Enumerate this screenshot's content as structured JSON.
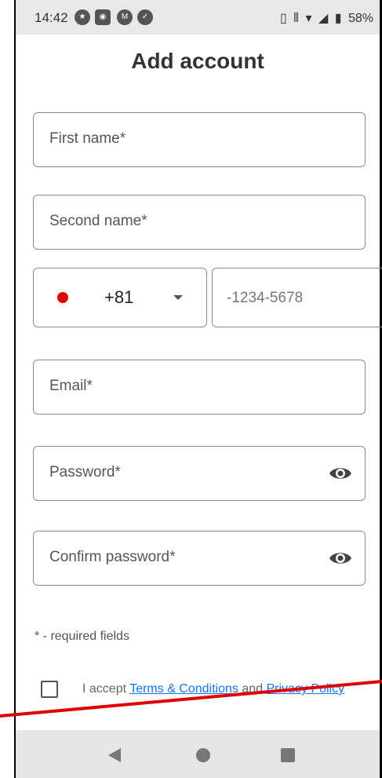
{
  "status_bar": {
    "time": "14:42",
    "battery": "58%"
  },
  "page": {
    "title": "Add account"
  },
  "form": {
    "first_name_placeholder": "First name*",
    "second_name_placeholder": "Second name*",
    "country_code": "+81",
    "phone_placeholder": "-1234-5678",
    "email_placeholder": "Email*",
    "password_placeholder": "Password*",
    "confirm_password_placeholder": "Confirm password*"
  },
  "footer": {
    "required_note": "* - required fields",
    "accept_prefix": "I accept ",
    "terms_link": "Terms & Conditions",
    "and_text": " and ",
    "privacy_link": "Privacy Policy"
  },
  "colors": {
    "flag_dot": "#e00000",
    "link": "#1a73e8",
    "annotation_line": "#e00000"
  }
}
